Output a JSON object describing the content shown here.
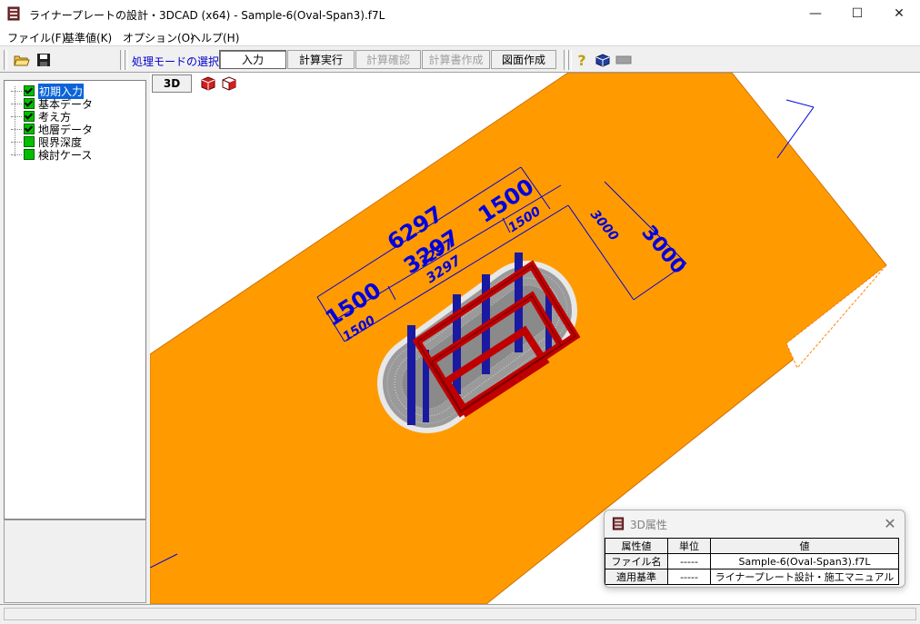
{
  "window": {
    "title": "ライナープレートの設計・3DCAD (x64) - Sample-6(Oval-Span3).f7L",
    "minimize": "—",
    "maximize": "☐",
    "close": "✕"
  },
  "menu": {
    "items": [
      {
        "label": "ファイル(F)"
      },
      {
        "label": "基準値(K)"
      },
      {
        "label": "オプション(O)"
      },
      {
        "label": "ヘルプ(H)"
      }
    ]
  },
  "toolbar": {
    "mode_label": "処理モードの選択",
    "buttons": [
      {
        "label": "入力",
        "state": "active"
      },
      {
        "label": "計算実行",
        "state": "enabled"
      },
      {
        "label": "計算確認",
        "state": "disabled"
      },
      {
        "label": "計算書作成",
        "state": "disabled"
      },
      {
        "label": "図面作成",
        "state": "enabled"
      }
    ],
    "help_symbol": "?"
  },
  "tree": {
    "items": [
      {
        "label": "初期入力",
        "checked": true,
        "selected": true
      },
      {
        "label": "基本データ",
        "checked": true,
        "selected": false
      },
      {
        "label": "考え方",
        "checked": true,
        "selected": false
      },
      {
        "label": "地層データ",
        "checked": true,
        "selected": false
      },
      {
        "label": "限界深度",
        "checked": false,
        "selected": false
      },
      {
        "label": "検討ケース",
        "checked": false,
        "selected": false
      }
    ]
  },
  "viewport": {
    "view_button": "3D",
    "dimensions": {
      "total_length": "6297",
      "straight_top": "3297",
      "straight_inner_a": "3297",
      "straight_inner_b": "3297",
      "radius_left": "1500",
      "radius_left_inner": "1500",
      "radius_right": "1500",
      "radius_right_inner": "1500",
      "width_outer": "3000",
      "width_inner": "3000"
    },
    "colors": {
      "ground": "#ff9b00",
      "dimension": "#0000e0",
      "frame": "#c00000",
      "post": "#1a1aa0",
      "liner": "#9a9a9a"
    }
  },
  "attr_dialog": {
    "title": "3D属性",
    "close": "✕",
    "headers": [
      "属性値",
      "単位",
      "値"
    ],
    "rows": [
      {
        "name": "ファイル名",
        "unit": "-----",
        "value": "Sample-6(Oval-Span3).f7L"
      },
      {
        "name": "適用基準",
        "unit": "-----",
        "value": "ライナープレート設計・施工マニュアル"
      }
    ]
  }
}
